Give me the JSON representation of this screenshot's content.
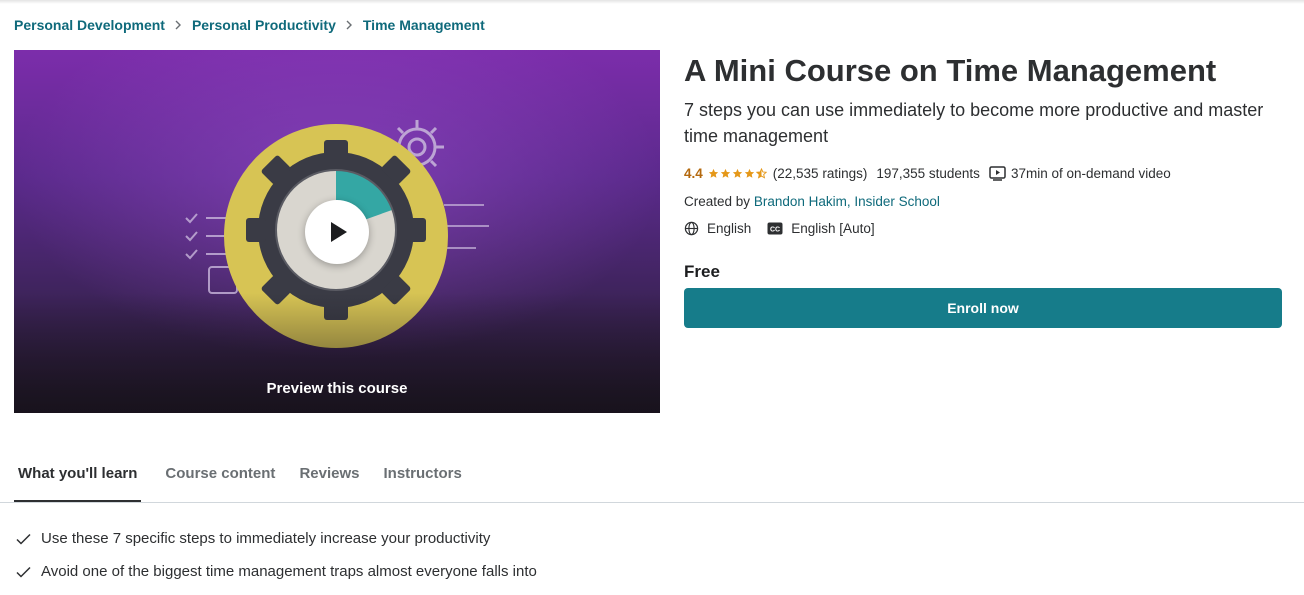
{
  "breadcrumb": [
    {
      "label": "Personal Development"
    },
    {
      "label": "Personal Productivity"
    },
    {
      "label": "Time Management"
    }
  ],
  "preview": {
    "label": "Preview this course",
    "play_icon": "play-icon"
  },
  "course": {
    "title": "A Mini Course on Time Management",
    "subtitle": "7 steps you can use immediately to become more productive and master time management",
    "rating": "4.4",
    "rating_value": 4.4,
    "ratings_count": "(22,535 ratings)",
    "students": "197,355 students",
    "video_length": "37min of on-demand video",
    "created_by_label": "Created by",
    "instructors": "Brandon Hakim, Insider School",
    "language": "English",
    "captions": "English [Auto]",
    "price": "Free",
    "enroll_label": "Enroll now"
  },
  "tabs": [
    {
      "label": "What you'll learn",
      "active": true
    },
    {
      "label": "Course content",
      "active": false
    },
    {
      "label": "Reviews",
      "active": false
    },
    {
      "label": "Instructors",
      "active": false
    }
  ],
  "learn_items": [
    "Use these 7 specific steps to immediately increase your productivity",
    "Avoid one of the biggest time management traps almost everyone falls into"
  ],
  "colors": {
    "accent": "#167c8a",
    "link": "#0f6a7b",
    "rating": "#b4690e",
    "star": "#e59819"
  }
}
